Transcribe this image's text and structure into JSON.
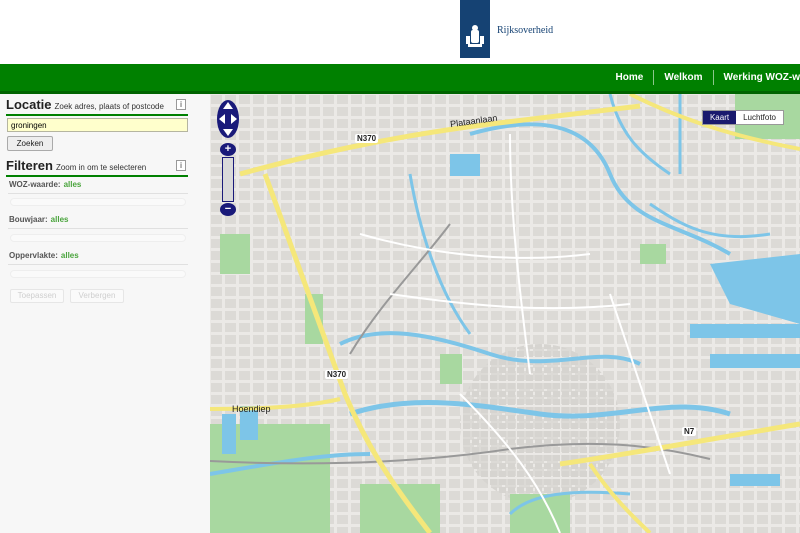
{
  "header": {
    "logo_text": "Rijksoverheid",
    "nav": [
      "Home",
      "Welkom",
      "Werking WOZ-w"
    ]
  },
  "panel": {
    "locatie": {
      "title": "Locatie",
      "subtitle": "Zoek adres, plaats of postcode",
      "info": "i",
      "input_value": "groningen",
      "search_label": "Zoeken"
    },
    "filteren": {
      "title": "Filteren",
      "subtitle": "Zoom in om te selecteren",
      "info": "i",
      "filters": [
        {
          "label": "WOZ-waarde:",
          "value": "alles"
        },
        {
          "label": "Bouwjaar:",
          "value": "alles"
        },
        {
          "label": "Oppervlakte:",
          "value": "alles"
        }
      ],
      "apply_label": "Toepassen",
      "hide_label": "Verbergen"
    }
  },
  "map": {
    "toggle": {
      "kaart": "Kaart",
      "luchtfoto": "Luchtfoto",
      "active": "Kaart"
    },
    "zoom_in": "+",
    "zoom_out": "−",
    "labels": {
      "n370_top": "N370",
      "n370_mid": "N370",
      "plataanlaan": "Plataanlaan",
      "hoendiep": "Hoendiep",
      "n7": "N7"
    },
    "colors": {
      "water": "#7dc5e8",
      "road_main": "#f5e77a",
      "green": "#a8d8a0",
      "land": "#ebe9e6"
    }
  },
  "colors": {
    "nav_green": "#008000",
    "brand_blue": "#154273",
    "control_blue": "#1a1a7a"
  }
}
